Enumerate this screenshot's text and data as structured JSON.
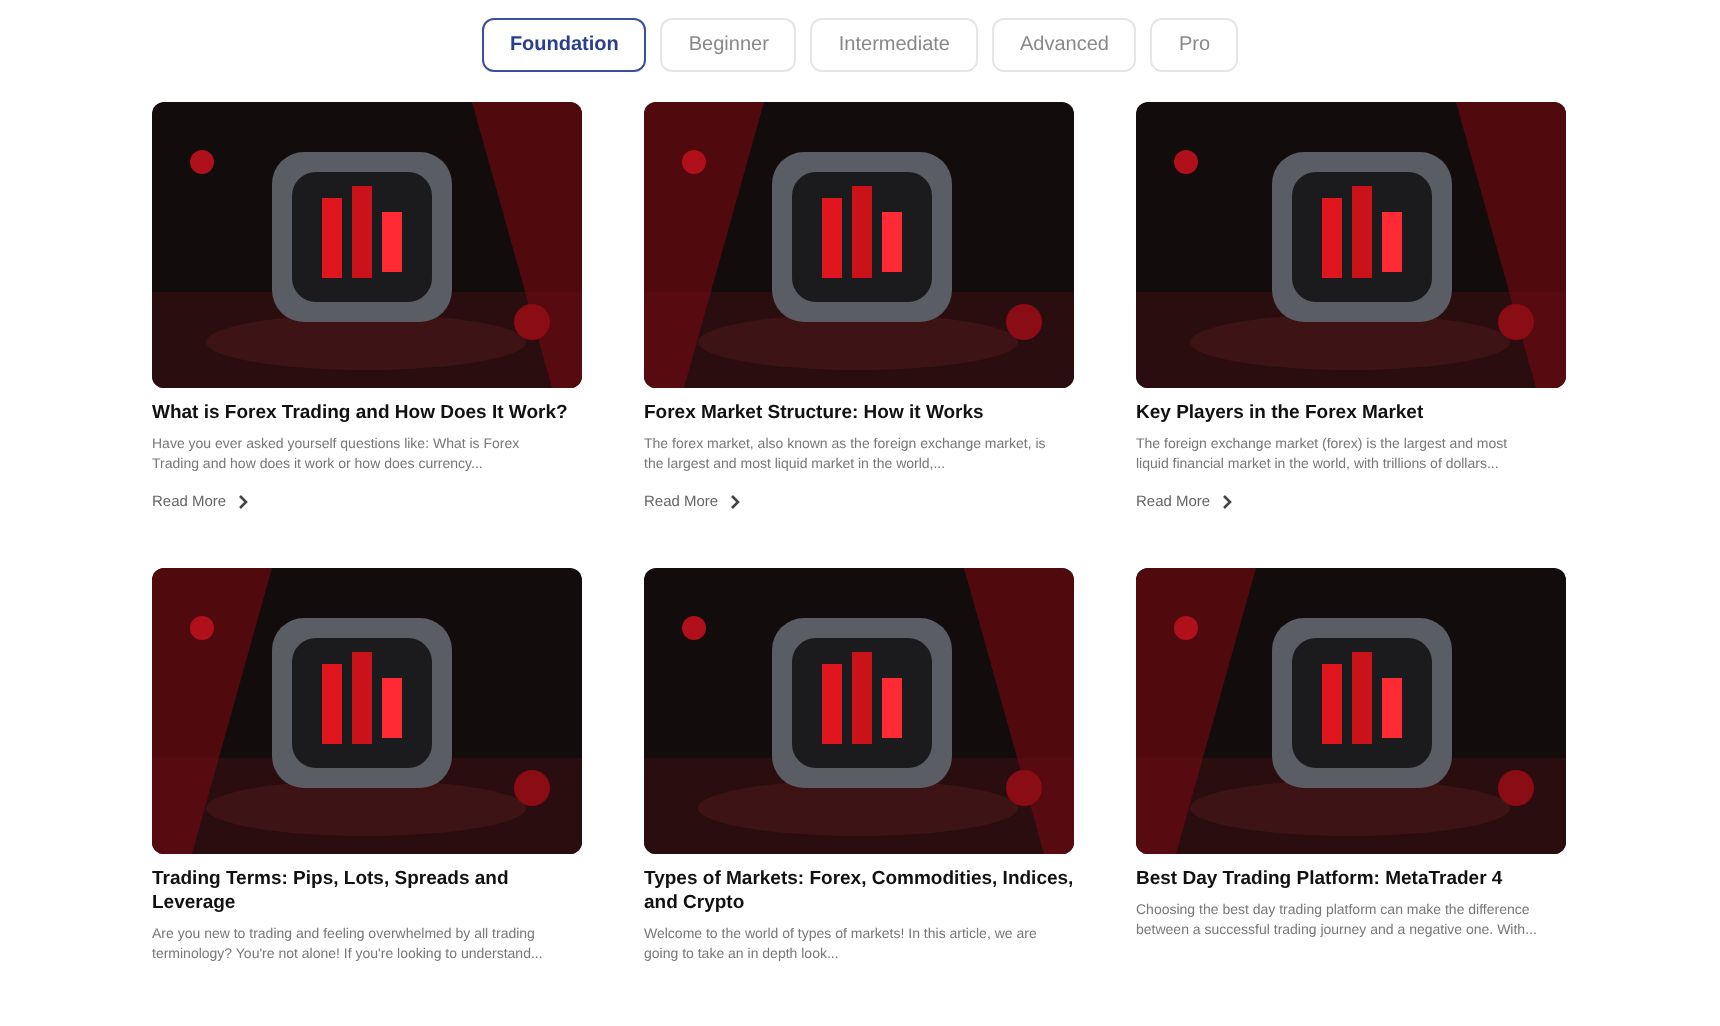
{
  "tabs": [
    {
      "label": "Foundation",
      "selected": true
    },
    {
      "label": "Beginner",
      "selected": false
    },
    {
      "label": "Intermediate",
      "selected": false
    },
    {
      "label": "Advanced",
      "selected": false
    },
    {
      "label": "Pro",
      "selected": false
    }
  ],
  "articles": [
    {
      "kind": "picture",
      "title": "What is Forex Trading and How Does It Work?",
      "excerpt": "Have you ever asked yourself questions like: What is Forex Trading and how does it work or how does currency...",
      "link": "Read More"
    },
    {
      "kind": "picture",
      "title": "Forex Market Structure: How it Works",
      "excerpt": "The forex market, also known as the foreign exchange market, is the largest and most liquid market in the world,...",
      "link": "Read More"
    },
    {
      "kind": "picture",
      "title": "Key Players in the Forex Market",
      "excerpt": "The foreign exchange market (forex) is the largest and most liquid financial market in the world, with trillions of dollars...",
      "link": "Read More"
    },
    {
      "kind": "picture",
      "title": "Trading Terms: Pips, Lots, Spreads and Leverage",
      "excerpt": "Are you new to trading and feeling overwhelmed by all trading terminology? You're not alone! If you're looking to understand..."
    },
    {
      "kind": "picture",
      "title": "Types of Markets: Forex, Commodities, Indices, and Crypto",
      "excerpt": "Welcome to the world of types of markets! In this article, we are going to take an in depth look..."
    },
    {
      "kind": "picture",
      "title": "Best Day Trading Platform: MetaTrader 4",
      "excerpt": "Choosing the best day trading platform can make the difference between a successful trading journey and a negative one. With..."
    }
  ]
}
